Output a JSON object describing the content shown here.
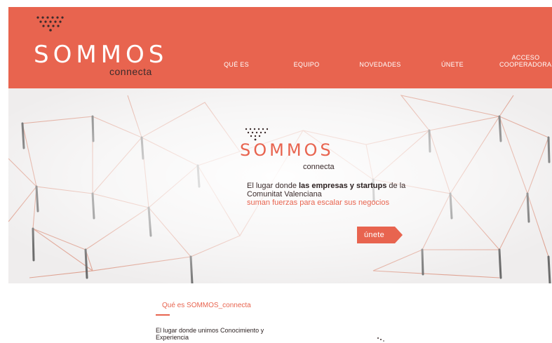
{
  "brand": {
    "name": "SOMMOS",
    "sub": "connecta"
  },
  "nav": {
    "items": [
      {
        "label": "QUÉ ES"
      },
      {
        "label": "EQUIPO"
      },
      {
        "label": "NOVEDADES"
      },
      {
        "label": "ÚNETE"
      },
      {
        "label": "ACCESO"
      },
      {
        "label": "COOPERADORAS"
      }
    ]
  },
  "hero": {
    "brand_name": "SOMMOS",
    "brand_sub": "connecta",
    "line1_pre": "El lugar donde ",
    "line1_strong": "las empresas y startups",
    "line1_post": " de la",
    "line2": "Comunitat Valenciana",
    "line3": "suman fuerzas para escalar sus negocios",
    "cta": "únete"
  },
  "section": {
    "title": "Qué es SOMMOS_connecta",
    "body": "El lugar donde unimos Conocimiento y Experiencia"
  },
  "colors": {
    "brand": "#e8644f",
    "dark": "#3b2b2b",
    "background": "#ffffff"
  }
}
